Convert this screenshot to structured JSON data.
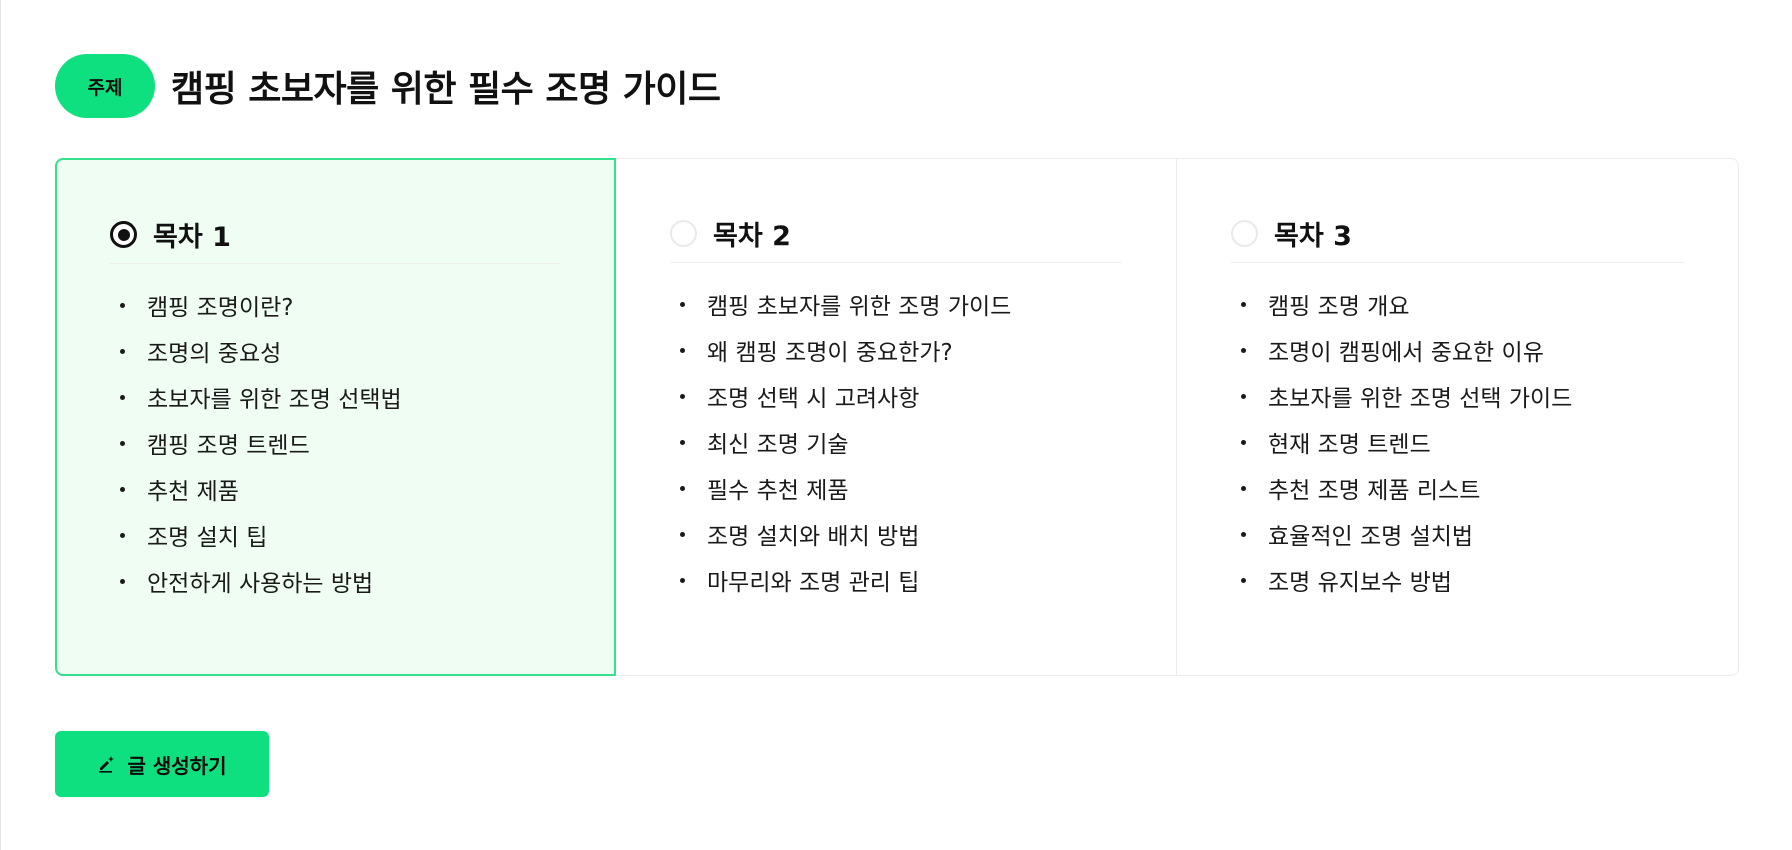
{
  "topic": {
    "badge": "주제",
    "title": "캠핑 초보자를 위한 필수 조명 가이드"
  },
  "outlines": [
    {
      "label": "목차 1",
      "selected": true,
      "items": [
        "캠핑 조명이란?",
        "조명의 중요성",
        "초보자를 위한 조명 선택법",
        "캠핑 조명 트렌드",
        "추천 제품",
        "조명 설치 팁",
        "안전하게 사용하는 방법"
      ]
    },
    {
      "label": "목차 2",
      "selected": false,
      "items": [
        "캠핑 초보자를 위한 조명 가이드",
        "왜 캠핑 조명이 중요한가?",
        "조명 선택 시 고려사항",
        "최신 조명 기술",
        "필수 추천 제품",
        "조명 설치와 배치 방법",
        "마무리와 조명 관리 팁"
      ]
    },
    {
      "label": "목차 3",
      "selected": false,
      "items": [
        "캠핑 조명 개요",
        "조명이 캠핑에서 중요한 이유",
        "초보자를 위한 조명 선택 가이드",
        "현재 조명 트렌드",
        "추천 조명 제품 리스트",
        "효율적인 조명 설치법",
        "조명 유지보수 방법"
      ]
    }
  ],
  "actions": {
    "generate_label": "글 생성하기",
    "generate_icon": "pen-sparkle-icon"
  },
  "colors": {
    "accent": "#0fe07f",
    "selected_bg": "#effdf3",
    "selected_border": "#37e08d"
  }
}
